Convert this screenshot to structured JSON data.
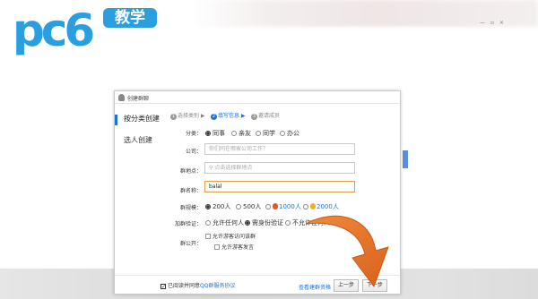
{
  "logo": {
    "letters": "pc6",
    "badge": "教学"
  },
  "dialog": {
    "title": "创建群聊",
    "sidebar": [
      {
        "label": "按分类创建"
      },
      {
        "label": "选人创建"
      }
    ],
    "steps": [
      {
        "num": "1",
        "label": "选择类别 ▶"
      },
      {
        "num": "2",
        "label": "填写信息 ▶"
      },
      {
        "num": "3",
        "label": "邀请成员"
      }
    ],
    "category": {
      "label": "分类：",
      "options": [
        "同事",
        "亲友",
        "同学",
        "办公"
      ]
    },
    "company": {
      "label": "公司：",
      "placeholder": "你们同在哪家公司工作？"
    },
    "location": {
      "label": "群地点：",
      "placeholder": "点击选择群地点"
    },
    "group_name": {
      "label": "群名称：",
      "value": "balal"
    },
    "group_size": {
      "label": "群规模：",
      "options": [
        "200人",
        "500人",
        "1000人",
        "2000人"
      ]
    },
    "join_verify": {
      "label": "加群验证：",
      "options": [
        "允许任何人",
        "需身份验证",
        "不允许任何人"
      ]
    },
    "public": {
      "label": "群公开：",
      "options": [
        "允许游客访问该群",
        "允许游客发言"
      ]
    },
    "footer": {
      "agree_prefix": "已阅读并同意",
      "agree_link": "QQ群服务协议",
      "view_link": "查看建群资格",
      "prev_button": "上一步",
      "next_button": "下一步"
    }
  },
  "colors": {
    "accent_blue": "#1e73d8",
    "logo_blue": "#2a9fe0",
    "arrow_orange": "#e4742c"
  }
}
